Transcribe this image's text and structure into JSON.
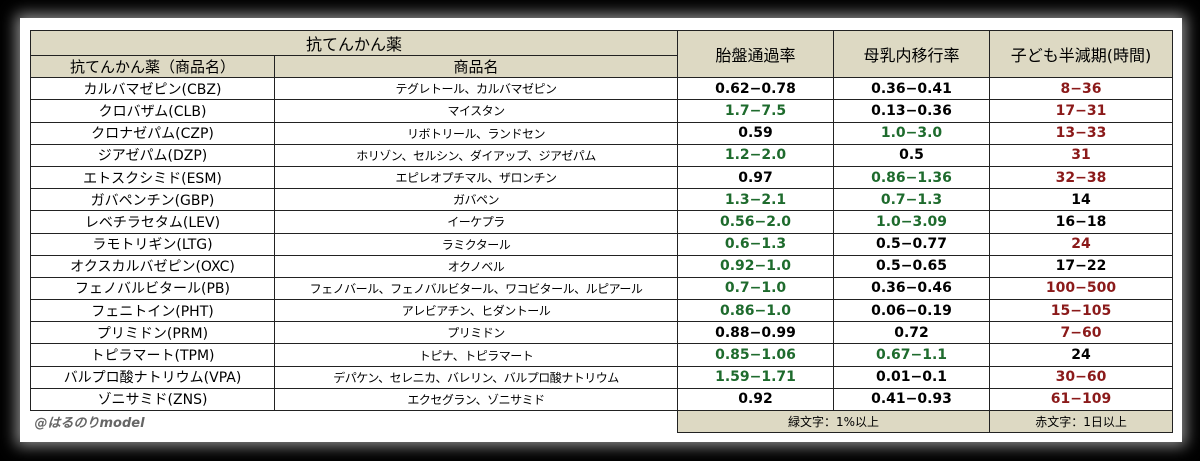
{
  "header": {
    "group_title": "抗てんかん薬",
    "col_drug": "抗てんかん薬（商品名）",
    "col_brand": "商品名",
    "col_placenta": "胎盤通過率",
    "col_milk": "母乳内移行率",
    "col_halflife": "子ども半減期(時間)"
  },
  "rows": [
    {
      "drug": "カルバマゼピン(CBZ)",
      "brand": "テグレトール、カルバマゼピン",
      "placenta": "0.62−0.78",
      "placenta_color": "black",
      "milk": "0.36−0.41",
      "milk_color": "black",
      "halflife": "8−36",
      "halflife_color": "red"
    },
    {
      "drug": "クロバザム(CLB)",
      "brand": "マイスタン",
      "placenta": "1.7−7.5",
      "placenta_color": "green",
      "milk": "0.13−0.36",
      "milk_color": "black",
      "halflife": "17−31",
      "halflife_color": "red"
    },
    {
      "drug": "クロナゼパム(CZP)",
      "brand": "リボトリール、ランドセン",
      "placenta": "0.59",
      "placenta_color": "black",
      "milk": "1.0−3.0",
      "milk_color": "green",
      "halflife": "13−33",
      "halflife_color": "red"
    },
    {
      "drug": "ジアゼパム(DZP)",
      "brand": "ホリゾン、セルシン、ダイアップ、ジアゼパム",
      "placenta": "1.2−2.0",
      "placenta_color": "green",
      "milk": "0.5",
      "milk_color": "black",
      "halflife": "31",
      "halflife_color": "red"
    },
    {
      "drug": "エトスクシミド(ESM)",
      "brand": "エピレオプチマル、ザロンチン",
      "placenta": "0.97",
      "placenta_color": "black",
      "milk": "0.86−1.36",
      "milk_color": "green",
      "halflife": "32−38",
      "halflife_color": "red"
    },
    {
      "drug": "ガバペンチン(GBP)",
      "brand": "ガバペン",
      "placenta": "1.3−2.1",
      "placenta_color": "green",
      "milk": "0.7−1.3",
      "milk_color": "green",
      "halflife": "14",
      "halflife_color": "black"
    },
    {
      "drug": "レベチラセタム(LEV)",
      "brand": "イーケプラ",
      "placenta": "0.56−2.0",
      "placenta_color": "green",
      "milk": "1.0−3.09",
      "milk_color": "green",
      "halflife": "16−18",
      "halflife_color": "black"
    },
    {
      "drug": "ラモトリギン(LTG)",
      "brand": "ラミクタール",
      "placenta": "0.6−1.3",
      "placenta_color": "green",
      "milk": "0.5−0.77",
      "milk_color": "black",
      "halflife": "24",
      "halflife_color": "red"
    },
    {
      "drug": "オクスカルバゼピン(OXC)",
      "brand": "オクノベル",
      "placenta": "0.92−1.0",
      "placenta_color": "green",
      "milk": "0.5−0.65",
      "milk_color": "black",
      "halflife": "17−22",
      "halflife_color": "black"
    },
    {
      "drug": "フェノバルビタール(PB)",
      "brand": "フェノバール、フェノバルビタール、ワコビタール、ルピアール",
      "placenta": "0.7−1.0",
      "placenta_color": "green",
      "milk": "0.36−0.46",
      "milk_color": "black",
      "halflife": "100−500",
      "halflife_color": "red"
    },
    {
      "drug": "フェニトイン(PHT)",
      "brand": "アレビアチン、ヒダントール",
      "placenta": "0.86−1.0",
      "placenta_color": "green",
      "milk": "0.06−0.19",
      "milk_color": "black",
      "halflife": "15−105",
      "halflife_color": "red"
    },
    {
      "drug": "プリミドン(PRM)",
      "brand": "プリミドン",
      "placenta": "0.88−0.99",
      "placenta_color": "black",
      "milk": "0.72",
      "milk_color": "black",
      "halflife": "7−60",
      "halflife_color": "red"
    },
    {
      "drug": "トピラマート(TPM)",
      "brand": "トピナ、トピラマート",
      "placenta": "0.85−1.06",
      "placenta_color": "green",
      "milk": "0.67−1.1",
      "milk_color": "green",
      "halflife": "24",
      "halflife_color": "black"
    },
    {
      "drug": "バルプロ酸ナトリウム(VPA)",
      "brand": "デパケン、セレニカ、バレリン、バルプロ酸ナトリウム",
      "placenta": "1.59−1.71",
      "placenta_color": "green",
      "milk": "0.01−0.1",
      "milk_color": "black",
      "halflife": "30−60",
      "halflife_color": "red"
    },
    {
      "drug": "ゾニサミド(ZNS)",
      "brand": "エクセグラン、ゾニサミド",
      "placenta": "0.92",
      "placenta_color": "black",
      "milk": "0.41−0.93",
      "milk_color": "black",
      "halflife": "61−109",
      "halflife_color": "red"
    }
  ],
  "footer": {
    "credit": "@はるのりmodel",
    "green_note": "緑文字：1%以上",
    "red_note": "赤文字：1日以上"
  }
}
